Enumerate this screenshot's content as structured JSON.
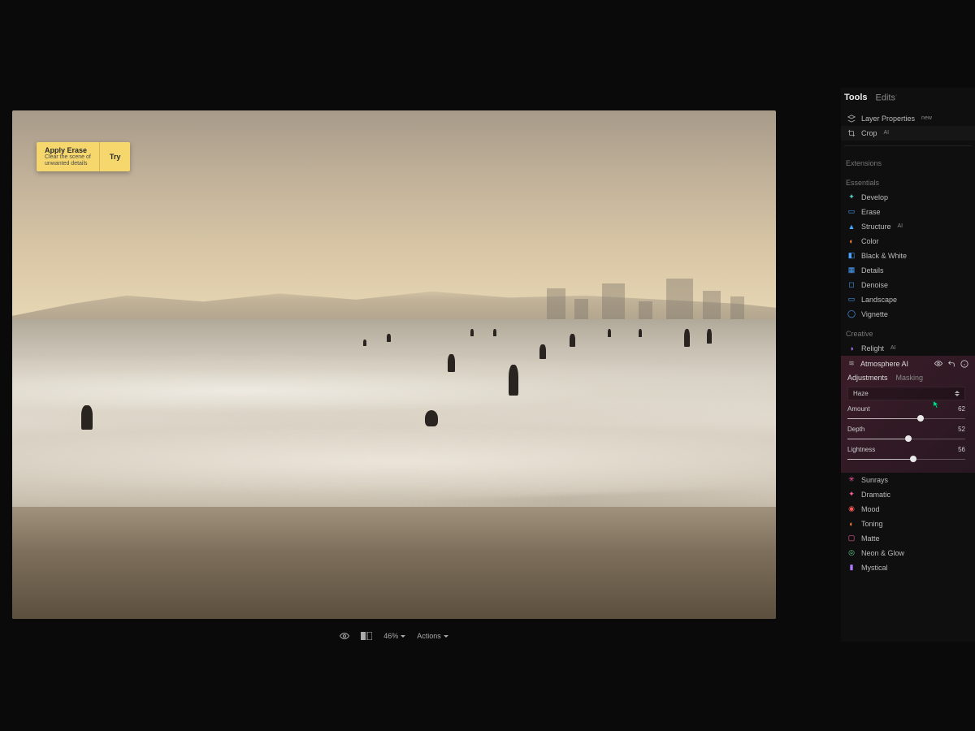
{
  "suggestion": {
    "title": "Apply Erase",
    "desc": "Clear the scene of\nunwanted details",
    "try_label": "Try"
  },
  "bottombar": {
    "zoom": "46%",
    "actions_label": "Actions"
  },
  "panel": {
    "tabs": {
      "tools": "Tools",
      "edits": "Edits"
    },
    "layer_properties": "Layer Properties",
    "crop": "Crop",
    "section_extensions": "Extensions",
    "section_essentials": "Essentials",
    "essentials": {
      "develop": "Develop",
      "erase": "Erase",
      "structure": "Structure",
      "color": "Color",
      "bw": "Black & White",
      "details": "Details",
      "denoise": "Denoise",
      "landscape": "Landscape",
      "vignette": "Vignette"
    },
    "section_creative": "Creative",
    "creative": {
      "relight": "Relight",
      "atmosphere": "Atmosphere",
      "sunrays": "Sunrays",
      "dramatic": "Dramatic",
      "mood": "Mood",
      "toning": "Toning",
      "matte": "Matte",
      "neon": "Neon & Glow",
      "mystical": "Mystical"
    }
  },
  "atmosphere": {
    "title": "Atmosphere",
    "tabs": {
      "adjustments": "Adjustments",
      "masking": "Masking"
    },
    "haze_label": "Haze",
    "sliders": {
      "amount": {
        "label": "Amount",
        "value": 62
      },
      "depth": {
        "label": "Depth",
        "value": 52
      },
      "lightness": {
        "label": "Lightness",
        "value": 56
      }
    }
  }
}
